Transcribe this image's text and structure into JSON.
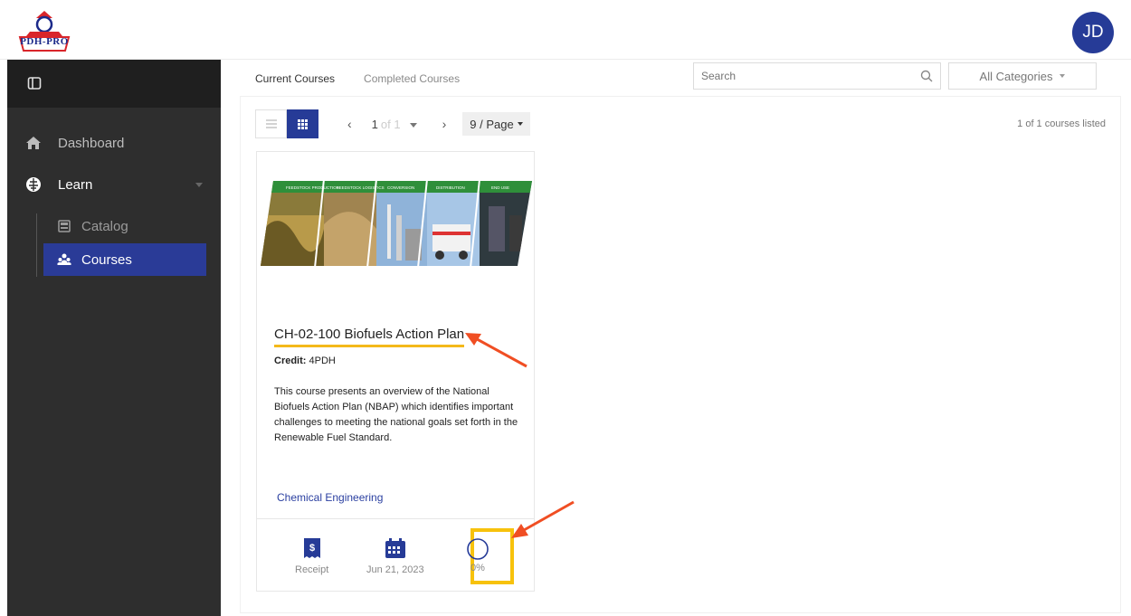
{
  "header": {
    "logo_text": "PDH-PRO",
    "avatar_initials": "JD"
  },
  "sidebar": {
    "items": [
      {
        "label": "Dashboard",
        "icon": "home-icon"
      },
      {
        "label": "Learn",
        "icon": "brain-icon"
      },
      {
        "label": "Catalog",
        "icon": "catalog-icon"
      },
      {
        "label": "Courses",
        "icon": "people-icon",
        "active": true
      }
    ]
  },
  "tabs": [
    {
      "label": "Current Courses",
      "active": true
    },
    {
      "label": "Completed Courses",
      "active": false
    }
  ],
  "search": {
    "placeholder": "Search"
  },
  "category_select": {
    "value": "All Categories"
  },
  "pager": {
    "page": "1",
    "of_text": "of 1",
    "per_page": "9 / Page",
    "count_text": "1 of 1 courses listed"
  },
  "course": {
    "image_labels": [
      "FEEDSTOCK PRODUCTION",
      "FEEDSTOCK LOGISTICS",
      "CONVERSION",
      "DISTRIBUTION",
      "END USE"
    ],
    "title": "CH-02-100 Biofuels Action Plan",
    "credit_label": "Credit:",
    "credit_value": "4PDH",
    "description": "This course presents an overview of the National Biofuels Action Plan (NBAP) which identifies important challenges to meeting the national goals set forth in the Renewable Fuel Standard.",
    "category": "Chemical Engineering",
    "receipt_label": "Receipt",
    "date": "Jun 21, 2023",
    "progress": "0%"
  },
  "colors": {
    "accent": "#263b97",
    "highlight": "#f7c20c",
    "annotation_arrow": "#f04e23"
  }
}
